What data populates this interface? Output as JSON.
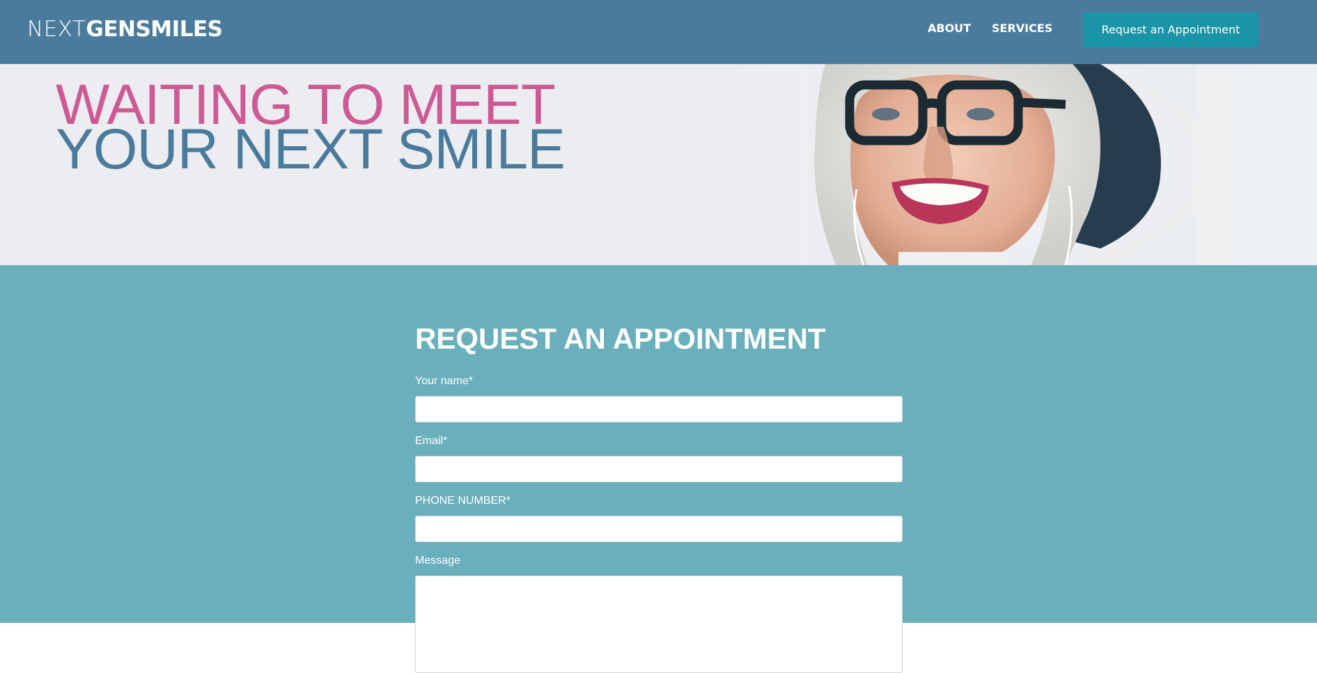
{
  "header": {
    "logo_thin": "NEXTGEN",
    "logo_bold_1": "GEN",
    "logo_bold_2": "SMILES",
    "nav": {
      "about": "ABOUT",
      "services": "SERVICES"
    },
    "cta_label": "Request an Appointment"
  },
  "hero": {
    "line_1": "WAITING TO MEET",
    "line_2": "YOUR NEXT SMILE"
  },
  "form": {
    "title": "REQUEST AN APPOINTMENT",
    "name_label": "Your name*",
    "name_value": "",
    "email_label": "Email*",
    "email_value": "",
    "phone_label": "PHONE NUMBER*",
    "phone_value": "",
    "message_label": "Message",
    "message_value": ""
  },
  "colors": {
    "header_bg": "#4a7b9d",
    "cta_bg": "#1c94a8",
    "hero_pink": "#cd5a95",
    "hero_blue": "#4a7b9d",
    "form_bg": "#6aafbc"
  },
  "icons": {
    "portrait": "smiling-senior-woman-photo"
  }
}
